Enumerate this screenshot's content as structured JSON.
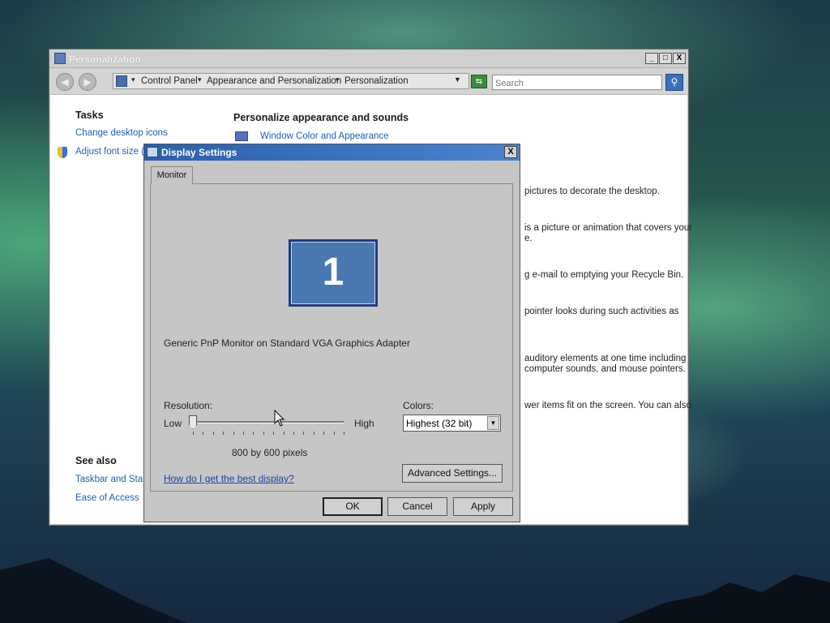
{
  "window": {
    "title": "Personalization",
    "controls": {
      "minimize": "_",
      "maximize": "□",
      "close": "X"
    },
    "nav": {
      "back": "◀",
      "forward": "▶",
      "breadcrumbs": [
        "Control Panel",
        "Appearance and Personalization",
        "Personalization"
      ],
      "go": "⇆",
      "search_placeholder": "Search",
      "search_button": "⚲"
    },
    "sidebar": {
      "tasks_heading": "Tasks",
      "tasks": [
        "Change desktop icons",
        "Adjust font size (D"
      ],
      "see_also_heading": "See also",
      "see_also": [
        "Taskbar and Start",
        "Ease of Access"
      ]
    },
    "main": {
      "heading": "Personalize appearance and sounds",
      "first_link": "Window Color and Appearance",
      "descriptions": [
        "pictures to decorate the desktop.",
        "is a picture or animation that covers your",
        "e.",
        "g e-mail to emptying your Recycle Bin.",
        "pointer looks during such activities as",
        "auditory elements at one time including",
        "computer sounds, and mouse pointers.",
        "wer items fit on the screen. You can also"
      ]
    }
  },
  "dialog": {
    "title": "Display Settings",
    "close": "X",
    "tab": "Monitor",
    "monitor_number": "1",
    "monitor_label": "Generic PnP Monitor on Standard VGA Graphics Adapter",
    "resolution_label": "Resolution:",
    "low": "Low",
    "high": "High",
    "resolution_level": 0,
    "resolution_text": "800 by 600 pixels",
    "colors_label": "Colors:",
    "colors_value": "Highest (32 bit)",
    "dropdown_arrow": "▼",
    "help_link": "How do I get the best display?",
    "advanced_button": "Advanced Settings...",
    "ok": "OK",
    "cancel": "Cancel",
    "apply": "Apply"
  },
  "colors": {
    "dialog_title": "#2c5fab",
    "link": "#1f5fb3",
    "monitor": "#4a78b0"
  }
}
